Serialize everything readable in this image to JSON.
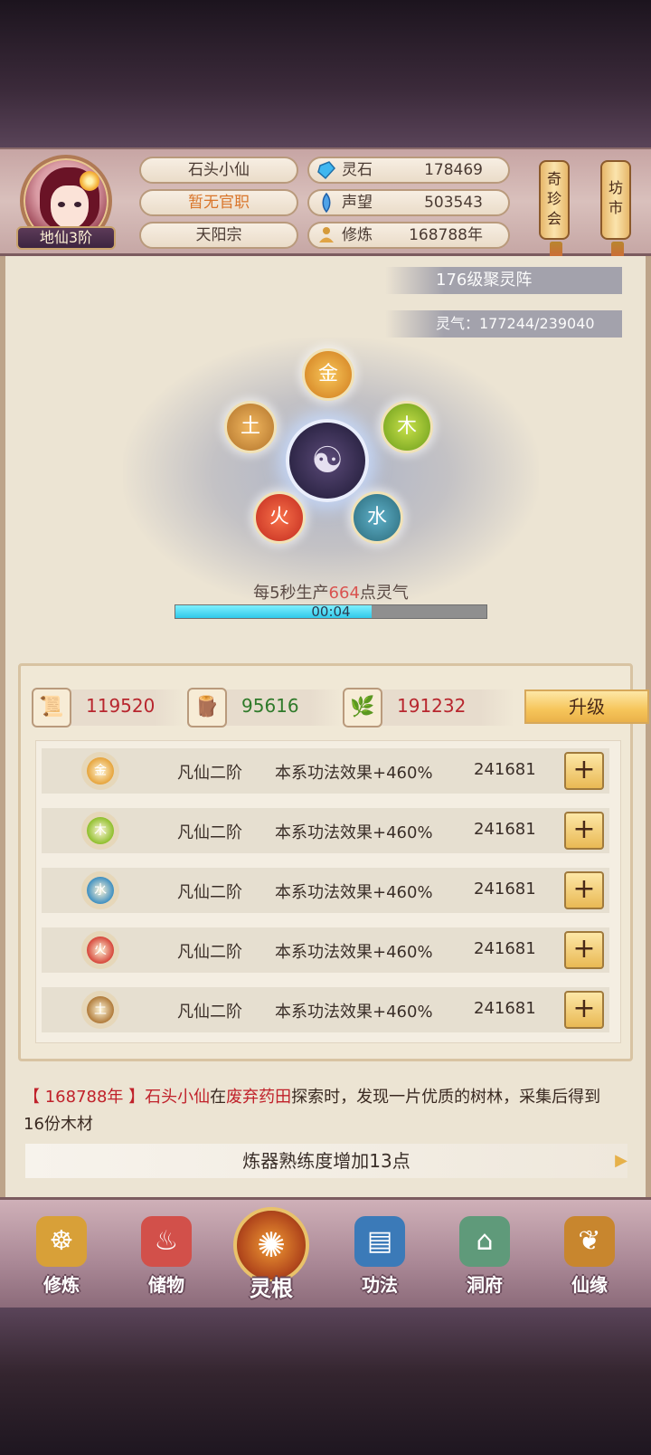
{
  "player": {
    "name": "石头小仙",
    "title": "暂无官职",
    "sect": "天阳宗",
    "realm": "地仙3阶"
  },
  "resources": [
    {
      "label": "灵石",
      "value": "178469",
      "icon": "spirit-stone-icon"
    },
    {
      "label": "声望",
      "value": "503543",
      "icon": "reputation-icon"
    },
    {
      "label": "修炼",
      "value": "168788年",
      "icon": "meditation-icon"
    }
  ],
  "side_buttons": {
    "treasure_label": "奇珍会",
    "market_label": "坊市"
  },
  "array": {
    "level_label": "176级聚灵阵",
    "qi_label": "灵气：177244/239040",
    "elements": {
      "metal": "金",
      "wood": "木",
      "earth": "土",
      "fire": "火",
      "water": "水"
    },
    "center_icon": "yinyang-icon",
    "prod_prefix": "每5秒生产",
    "prod_value": "664",
    "prod_suffix": "点灵气",
    "timer": "00:04",
    "timer_progress": 0.63
  },
  "materials": [
    {
      "icon": "scroll-icon",
      "value": "119520",
      "color": "#b8262e"
    },
    {
      "icon": "wood-icon",
      "value": "95616",
      "color": "#2f7a2a"
    },
    {
      "icon": "herb-icon",
      "value": "191232",
      "color": "#b8262e"
    }
  ],
  "upgrade_label": "升级",
  "roots": [
    {
      "element": "金",
      "rank": "凡仙二阶",
      "effect": "本系功法效果+460%",
      "cost": "241681",
      "color": "#e6a43b"
    },
    {
      "element": "木",
      "rank": "凡仙二阶",
      "effect": "本系功法效果+460%",
      "cost": "241681",
      "color": "#8fbf2c"
    },
    {
      "element": "水",
      "rank": "凡仙二阶",
      "effect": "本系功法效果+460%",
      "cost": "241681",
      "color": "#3f8fc0"
    },
    {
      "element": "火",
      "rank": "凡仙二阶",
      "effect": "本系功法效果+460%",
      "cost": "241681",
      "color": "#d6463a"
    },
    {
      "element": "土",
      "rank": "凡仙二阶",
      "effect": "本系功法效果+460%",
      "cost": "241681",
      "color": "#b07a3a"
    }
  ],
  "log": {
    "year": "【 168788年 】",
    "actor": "石头小仙",
    "connector": "在",
    "place": "废弃药田",
    "text": "探索时，发现一片优质的树林，采集后得到16份木材"
  },
  "notice": "炼器熟练度增加13点",
  "nav": [
    {
      "label": "修炼",
      "icon": "cultivate-icon",
      "color": "#d8a038"
    },
    {
      "label": "储物",
      "icon": "storage-bag-icon",
      "color": "#d2504a"
    },
    {
      "label": "灵根",
      "icon": "spirit-root-icon",
      "color": "#c2612a"
    },
    {
      "label": "功法",
      "icon": "technique-book-icon",
      "color": "#3b7ab8"
    },
    {
      "label": "洞府",
      "icon": "cave-mansion-icon",
      "color": "#5f9a7a"
    },
    {
      "label": "仙缘",
      "icon": "gourd-icon",
      "color": "#c8862e"
    }
  ]
}
